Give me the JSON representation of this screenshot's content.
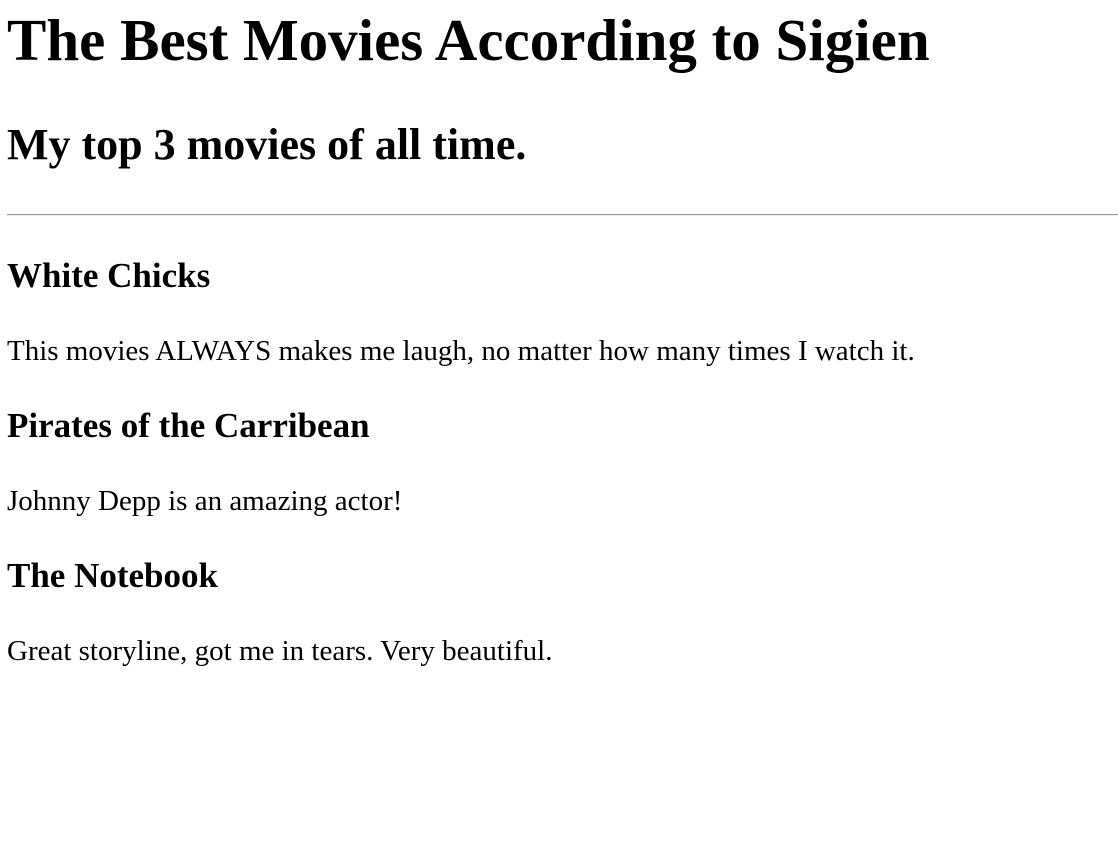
{
  "page": {
    "title": "The Best Movies According to Sigien",
    "subtitle": "My top 3 movies of all time."
  },
  "movies": [
    {
      "name": "White Chicks",
      "comment": "This movies ALWAYS makes me laugh, no matter how many times I watch it."
    },
    {
      "name": "Pirates of the Carribean",
      "comment": "Johnny Depp is an amazing actor!"
    },
    {
      "name": "The Notebook",
      "comment": "Great storyline, got me in tears. Very beautiful."
    }
  ]
}
